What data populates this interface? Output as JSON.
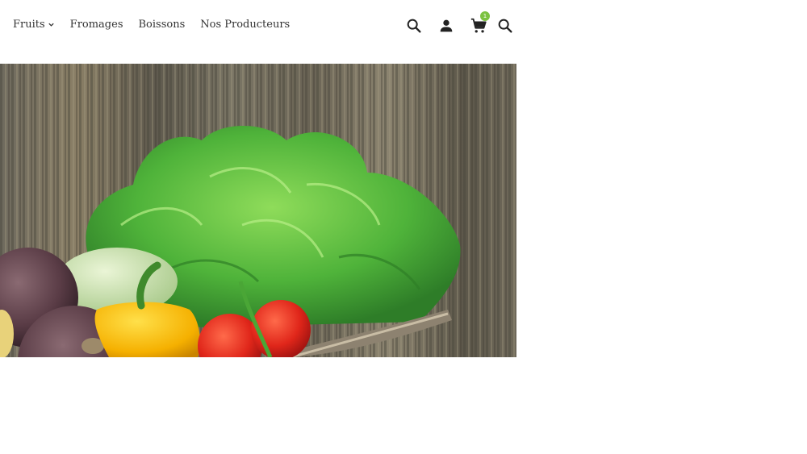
{
  "nav": {
    "items": [
      {
        "label": "Fruits",
        "has_dropdown": true
      },
      {
        "label": "Fromages",
        "has_dropdown": false
      },
      {
        "label": "Boissons",
        "has_dropdown": false
      },
      {
        "label": "Nos Producteurs",
        "has_dropdown": false
      }
    ]
  },
  "header_icons": {
    "search": "search-icon",
    "account": "user-icon",
    "cart": "cart-icon",
    "cart_count": "1",
    "search_secondary": "search-icon"
  },
  "colors": {
    "nav_text": "#333333",
    "icon": "#222222",
    "badge": "#7cc242",
    "background": "#ffffff"
  },
  "hero": {
    "image": "vegetable-basket"
  }
}
